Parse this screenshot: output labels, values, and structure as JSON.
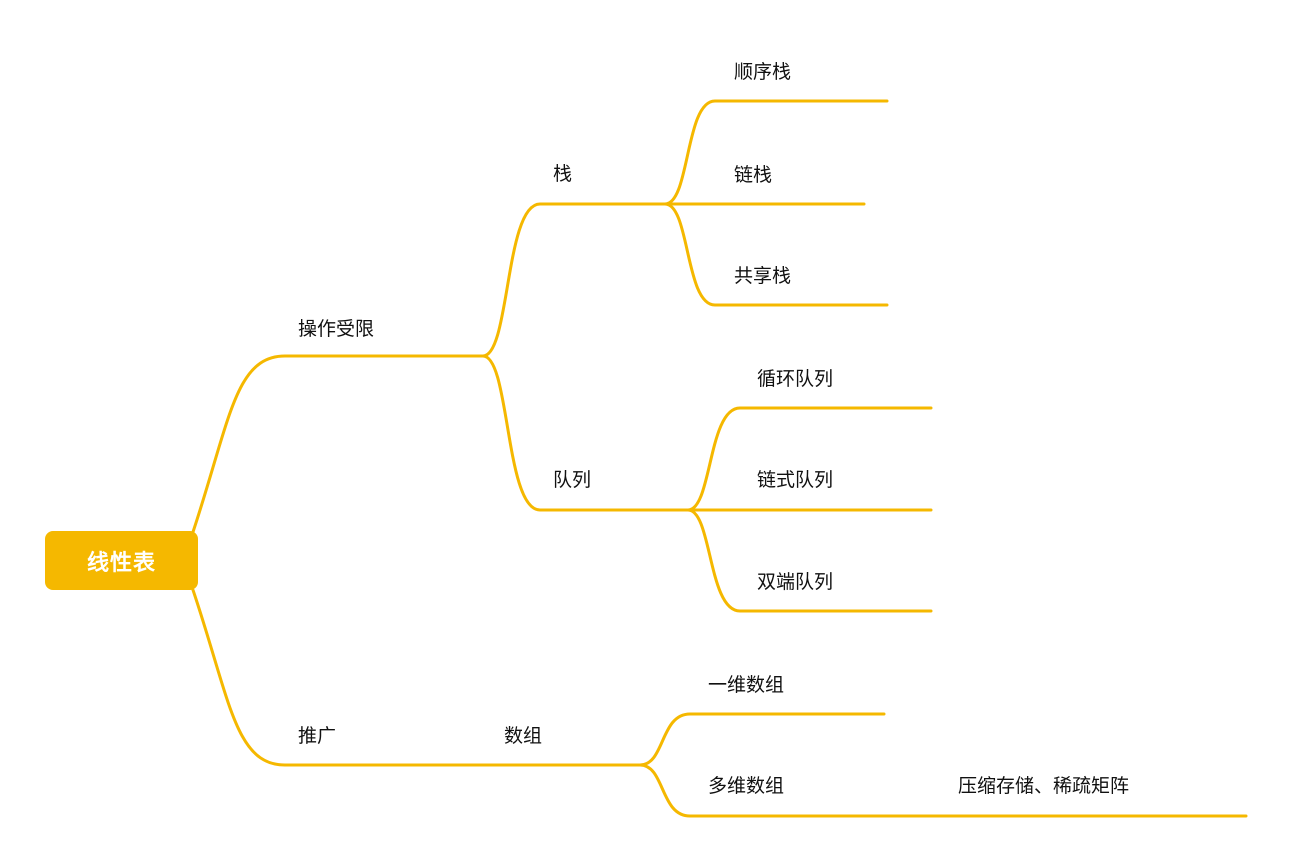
{
  "colors": {
    "branch": "#f5b800",
    "root_fill": "#f5b800",
    "root_text": "#ffffff",
    "text": "#111111"
  },
  "root": {
    "label": "线性表"
  },
  "branches": {
    "restricted": {
      "label": "操作受限",
      "stack": {
        "label": "栈",
        "children": [
          "顺序栈",
          "链栈",
          "共享栈"
        ]
      },
      "queue": {
        "label": "队列",
        "children": [
          "循环队列",
          "链式队列",
          "双端队列"
        ]
      }
    },
    "generalized": {
      "label": "推广",
      "array": {
        "label": "数组",
        "children": [
          "一维数组",
          "多维数组"
        ],
        "multi_note": "压缩存储、稀疏矩阵"
      }
    }
  }
}
